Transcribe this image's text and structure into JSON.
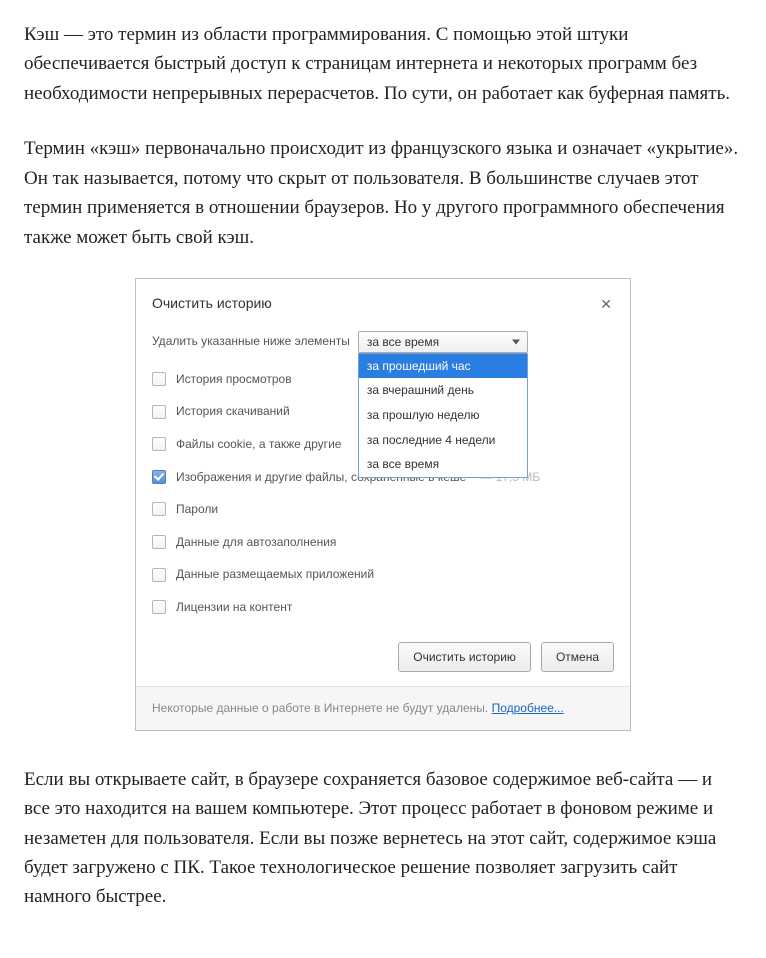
{
  "article": {
    "p1": "Кэш — это термин из области программирования. С помощью этой штуки обеспечивается быстрый доступ к страницам интернета и некоторых программ без необходимости непрерывных перерасчетов. По сути, он работает как буферная память.",
    "p2": "Термин «кэш» первоначально происходит из французского языка и означает «укрытие». Он так называется, потому что скрыт от пользователя. В большинстве случаев этот термин применяется в отношении браузеров. Но у другого программного обеспечения также может быть свой кэш.",
    "p3": "Если вы открываете сайт, в браузере сохраняется базовое содержимое веб-сайта — и все это находится на вашем компьютере. Этот процесс работает в фоновом режиме и незаметен для пользователя. Если вы позже вернетесь на этот сайт, содержимое кэша будет загружено с ПК. Такое технологическое решение позволяет загрузить сайт намного быстрее."
  },
  "dialog": {
    "title": "Очистить историю",
    "delete_label": "Удалить указанные ниже элементы",
    "select": {
      "selected": "за все время",
      "options": {
        "o0": "за прошедший час",
        "o1": "за вчерашний день",
        "o2": "за прошлую неделю",
        "o3": "за последние 4 недели",
        "o4": "за все время"
      },
      "highlighted_index": 0
    },
    "items": {
      "i0": {
        "label": "История просмотров",
        "checked": false
      },
      "i1": {
        "label": "История скачиваний",
        "checked": false
      },
      "i2": {
        "label": "Файлы cookie, а также другие",
        "checked": false
      },
      "i3": {
        "label": "Изображения и другие файлы, сохраненные в кеше",
        "checked": true,
        "suffix": "— 17,5 МБ"
      },
      "i4": {
        "label": "Пароли",
        "checked": false
      },
      "i5": {
        "label": "Данные для автозаполнения",
        "checked": false
      },
      "i6": {
        "label": "Данные размещаемых приложений",
        "checked": false
      },
      "i7": {
        "label": "Лицензии на контент",
        "checked": false
      }
    },
    "buttons": {
      "primary": "Очистить историю",
      "cancel": "Отмена"
    },
    "footer_text": "Некоторые данные о работе в Интернете не будут удалены.",
    "footer_link": "Подробнее..."
  }
}
